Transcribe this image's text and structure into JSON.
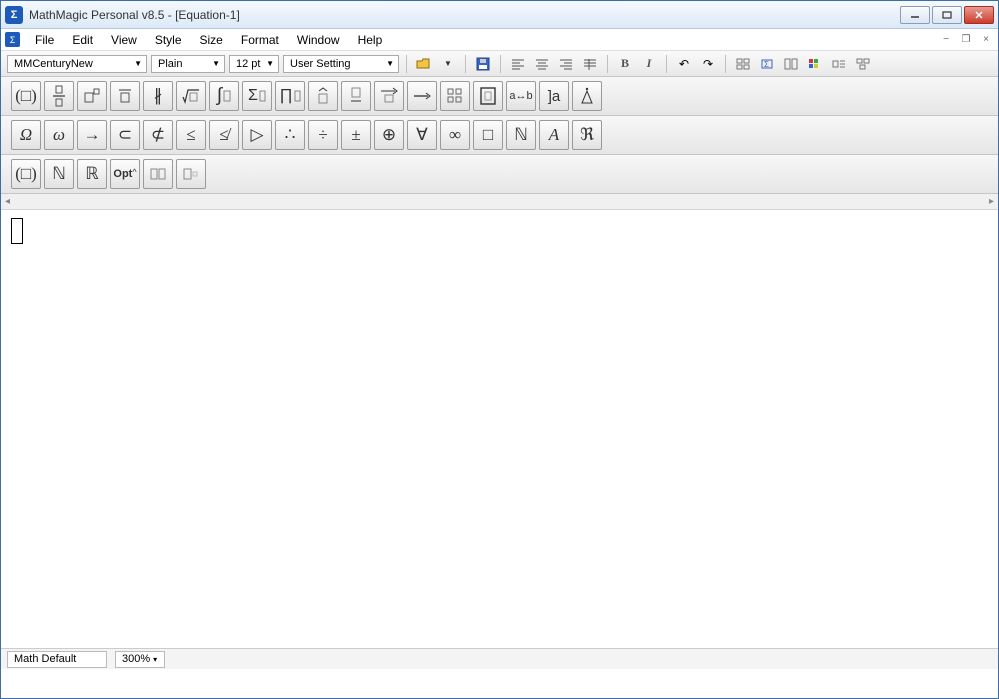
{
  "window": {
    "title": "MathMagic Personal v8.5 - [Equation-1]"
  },
  "menu": {
    "items": [
      "File",
      "Edit",
      "View",
      "Style",
      "Size",
      "Format",
      "Window",
      "Help"
    ]
  },
  "toolbar": {
    "font": "MMCenturyNew",
    "style": "Plain",
    "size": "12 pt",
    "setting": "User Setting"
  },
  "palette1": [
    "(□)",
    "□/□",
    "□□",
    "□̅",
    "∦",
    "√□",
    "∫□",
    "∑□",
    "∏□",
    "□̂",
    "□̱",
    "⟶",
    "↦",
    "⊞",
    "⫿",
    "a↔b",
    "]a",
    "⊥̇"
  ],
  "palette2": [
    "Ω",
    "ω",
    "→",
    "⊂",
    "⊄",
    "≤",
    "≰",
    "▷",
    "∴",
    "÷",
    "±",
    "⊕",
    "∀",
    "∞",
    "□",
    "ℕ",
    "A",
    "ℜ"
  ],
  "palette3": [
    "(□)",
    "ℕ",
    "ℝ",
    "Opt",
    "▫▫",
    "▫"
  ],
  "status": {
    "style": "Math Default",
    "zoom": "300%"
  }
}
